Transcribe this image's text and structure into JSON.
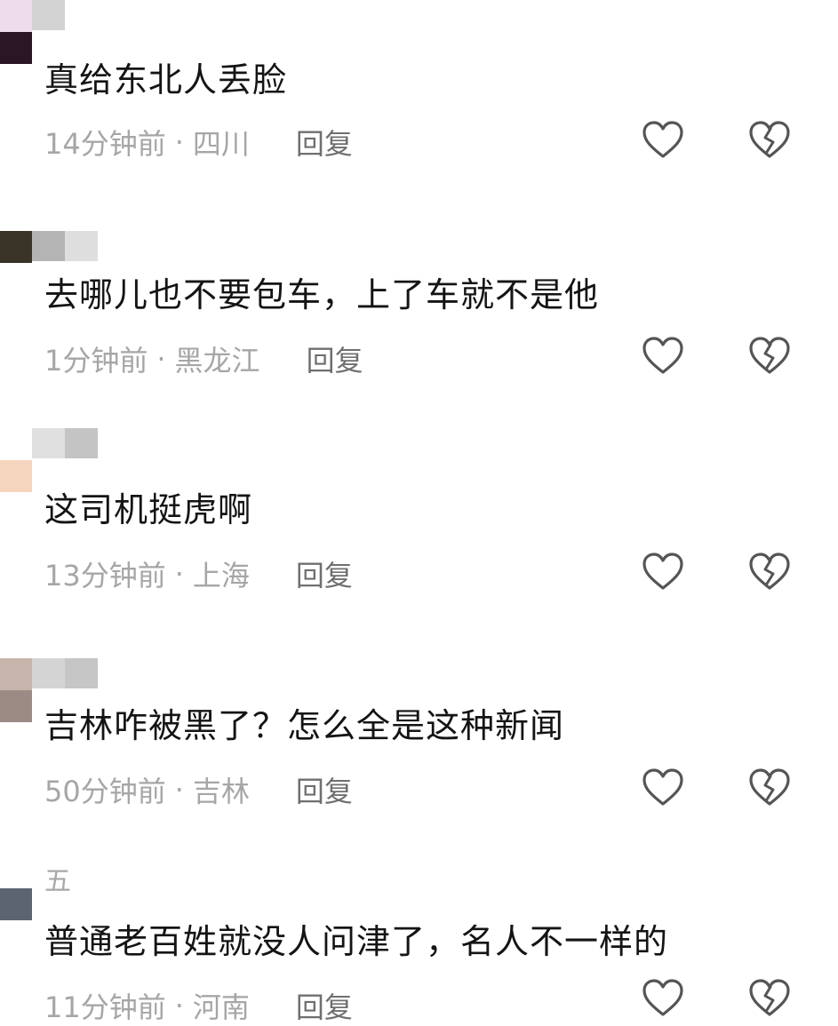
{
  "comments": [
    {
      "username": "",
      "text": "真给东北人丢脸",
      "time": "14分钟前",
      "location": "四川",
      "reply_label": "回复",
      "avatar_colors": [
        "#ecdcec",
        "#2a1624"
      ]
    },
    {
      "username": "",
      "text": "去哪儿也不要包车，上了车就不是他",
      "time": "1分钟前",
      "location": "黑龙江",
      "reply_label": "回复",
      "avatar_colors": [
        "#3a3328",
        "#cfcfcf"
      ]
    },
    {
      "username": "",
      "text": "这司机挺虎啊",
      "time": "13分钟前",
      "location": "上海",
      "reply_label": "回复",
      "avatar_colors": [
        "#f6d5bf",
        "#f3e7dc"
      ]
    },
    {
      "username": "",
      "text": "吉林咋被黑了？怎么全是这种新闻",
      "time": "50分钟前",
      "location": "吉林",
      "reply_label": "回复",
      "avatar_colors": [
        "#c7b4aa",
        "#9c8a85"
      ]
    },
    {
      "username": "五",
      "text": "普通老百姓就没人问津了，名人不一样的",
      "time": "11分钟前",
      "location": "河南",
      "reply_label": "回复",
      "avatar_colors": [
        "#5c6470",
        "#ffffff"
      ]
    }
  ],
  "icons": {
    "like": "heart-outline-icon",
    "dislike": "broken-heart-icon"
  },
  "colors": {
    "text": "#141414",
    "meta": "#a6a6a6",
    "reply": "#6f6f6f",
    "icon": "#555555"
  }
}
